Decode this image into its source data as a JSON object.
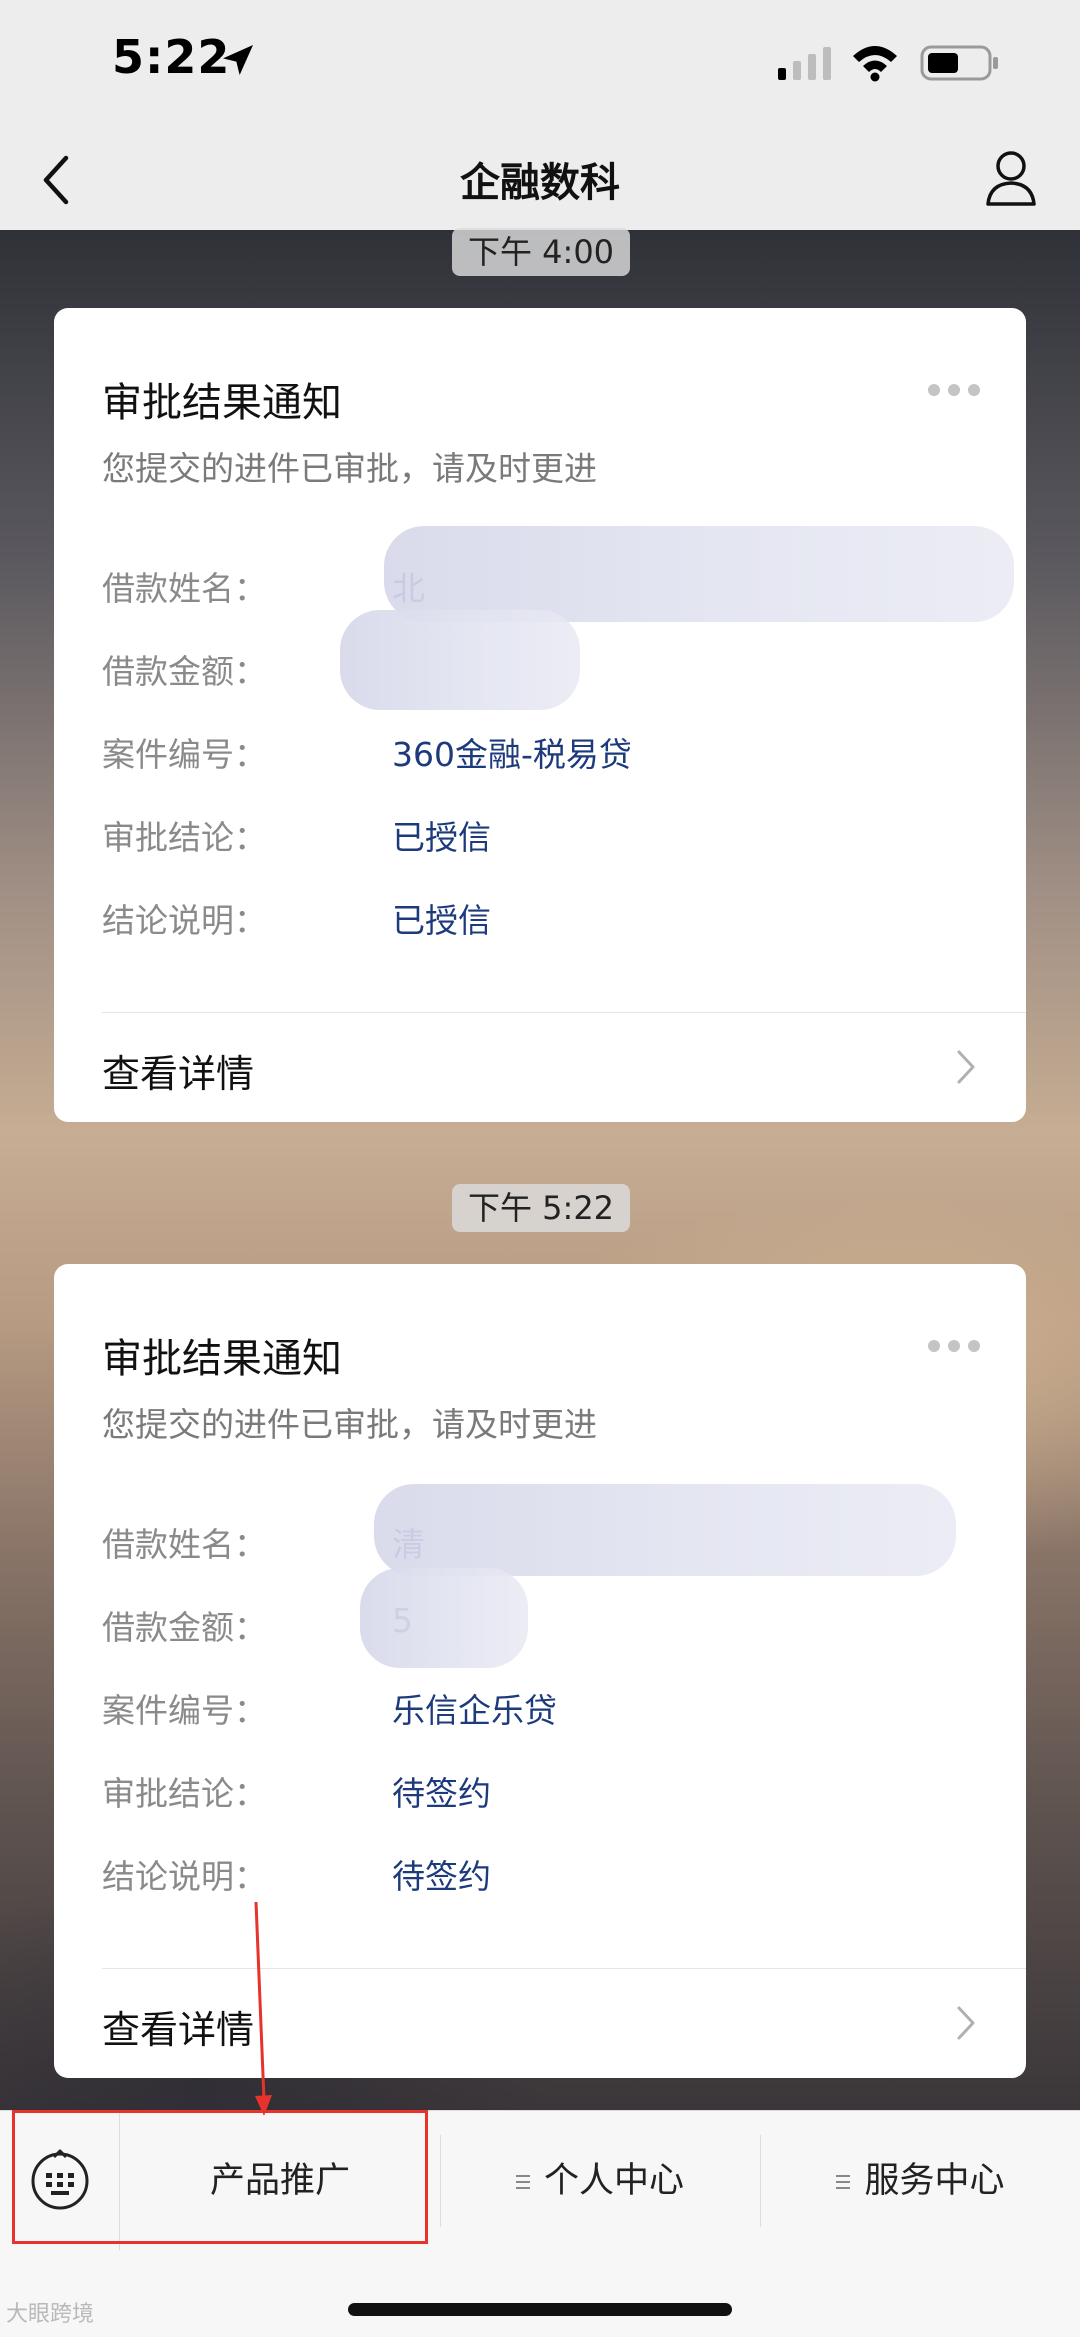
{
  "status_bar": {
    "time": "5:22",
    "icons": [
      "location-arrow-icon",
      "cellular-signal-icon",
      "wifi-icon",
      "battery-icon"
    ]
  },
  "nav": {
    "title": "企融数科",
    "back_icon": "chevron-left-icon",
    "profile_icon": "user-icon"
  },
  "messages": [
    {
      "time": "下午 4:00",
      "card": {
        "title": "审批结果通知",
        "subtitle": "您提交的进件已审批，请及时更进",
        "fields": [
          {
            "label": "借款姓名：",
            "value": "北"
          },
          {
            "label": "借款金额：",
            "value": ""
          },
          {
            "label": "案件编号：",
            "value": "360金融-税易贷"
          },
          {
            "label": "审批结论：",
            "value": "已授信"
          },
          {
            "label": "结论说明：",
            "value": "已授信"
          }
        ],
        "detail_label": "查看详情"
      }
    },
    {
      "time": "下午 5:22",
      "card": {
        "title": "审批结果通知",
        "subtitle": "您提交的进件已审批，请及时更进",
        "fields": [
          {
            "label": "借款姓名：",
            "value": "清"
          },
          {
            "label": "借款金额：",
            "value": "5"
          },
          {
            "label": "案件编号：",
            "value": "乐信企乐贷"
          },
          {
            "label": "审批结论：",
            "value": "待签约"
          },
          {
            "label": "结论说明：",
            "value": "待签约"
          }
        ],
        "detail_label": "查看详情"
      }
    }
  ],
  "menu": {
    "items": [
      {
        "label": "产品推广"
      },
      {
        "label": "个人中心"
      },
      {
        "label": "服务中心"
      }
    ]
  },
  "watermark": "大眼跨境",
  "colors": {
    "value_text": "#1c3a7c",
    "annotation": "#e8322c"
  }
}
